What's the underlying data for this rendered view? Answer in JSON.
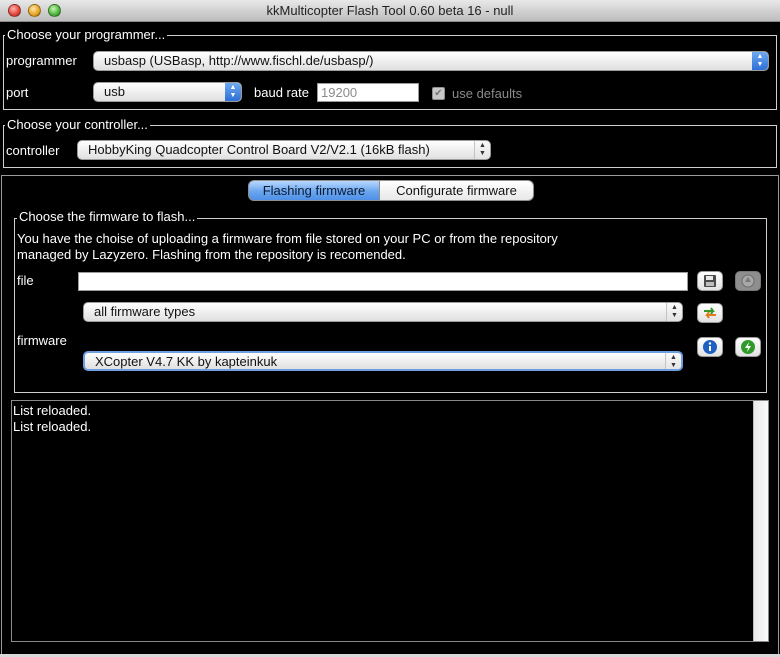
{
  "window": {
    "title": "kkMulticopter Flash Tool 0.60 beta 16 - null"
  },
  "programmer_group": {
    "legend": "Choose your programmer...",
    "programmer_label": "programmer",
    "programmer_value": "usbasp (USBasp, http://www.fischl.de/usbasp/)",
    "port_label": "port",
    "port_value": "usb",
    "baud_label": "baud rate",
    "baud_value": "19200",
    "use_defaults_label": "use defaults"
  },
  "controller_group": {
    "legend": "Choose your controller...",
    "controller_label": "controller",
    "controller_value": "HobbyKing Quadcopter Control Board V2/V2.1 (16kB flash)"
  },
  "tabs": [
    {
      "label": "Flashing firmware"
    },
    {
      "label": "Configurate firmware"
    }
  ],
  "firmware_group": {
    "legend": "Choose the firmware to flash...",
    "description_line1": "You have the choise of uploading a firmware from file stored on your PC or from the repository",
    "description_line2": "managed by Lazyzero. Flashing from the repository is recomended.",
    "file_label": "file",
    "file_value": "",
    "filter_value": "all firmware types",
    "firmware_label": "firmware",
    "firmware_value": "XCopter V4.7 KK by kapteinkuk"
  },
  "log": {
    "lines": [
      "List reloaded.",
      "List reloaded."
    ]
  },
  "icons": {
    "save": "floppy-disk-icon",
    "disabled": "gray-circle-icon",
    "refresh": "refresh-arrows-icon",
    "info": "info-icon",
    "flash": "green-flash-icon"
  }
}
